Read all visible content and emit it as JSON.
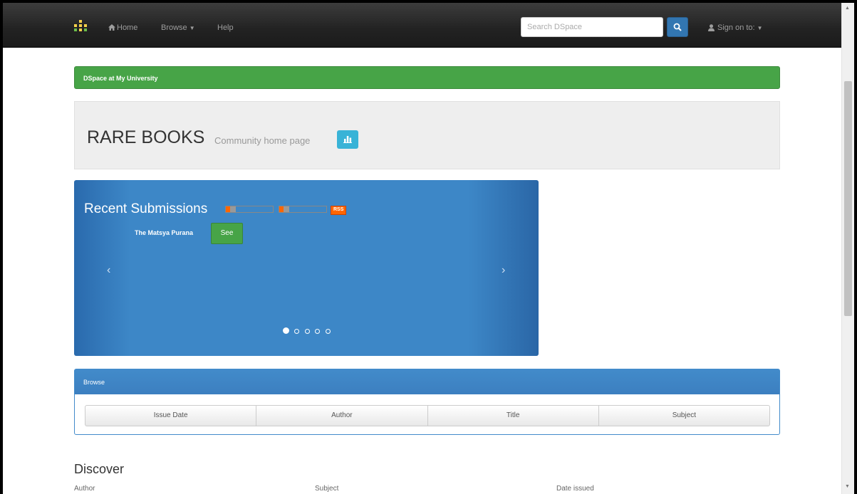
{
  "navbar": {
    "home_label": "Home",
    "browse_label": "Browse",
    "help_label": "Help",
    "search_placeholder": "Search DSpace",
    "signin_label": "Sign on to:"
  },
  "breadcrumb": {
    "label": "DSpace at My University"
  },
  "jumbotron": {
    "title": "RARE BOOKS",
    "subtitle": "Community home page"
  },
  "recent": {
    "heading": "Recent Submissions",
    "rss_label": "RSS",
    "item_title": "The Matsya Purana",
    "see_label": "See",
    "prev_label": "‹",
    "next_label": "›",
    "slides": 5,
    "active_slide": 1
  },
  "browse": {
    "heading": "Browse",
    "buttons": [
      "Issue Date",
      "Author",
      "Title",
      "Subject"
    ]
  },
  "discover": {
    "heading": "Discover",
    "columns": [
      "Author",
      "Subject",
      "Date issued"
    ]
  },
  "colors": {
    "navbar": "#222222",
    "success": "#47a447",
    "primary": "#428bca",
    "info": "#39b3d7"
  }
}
